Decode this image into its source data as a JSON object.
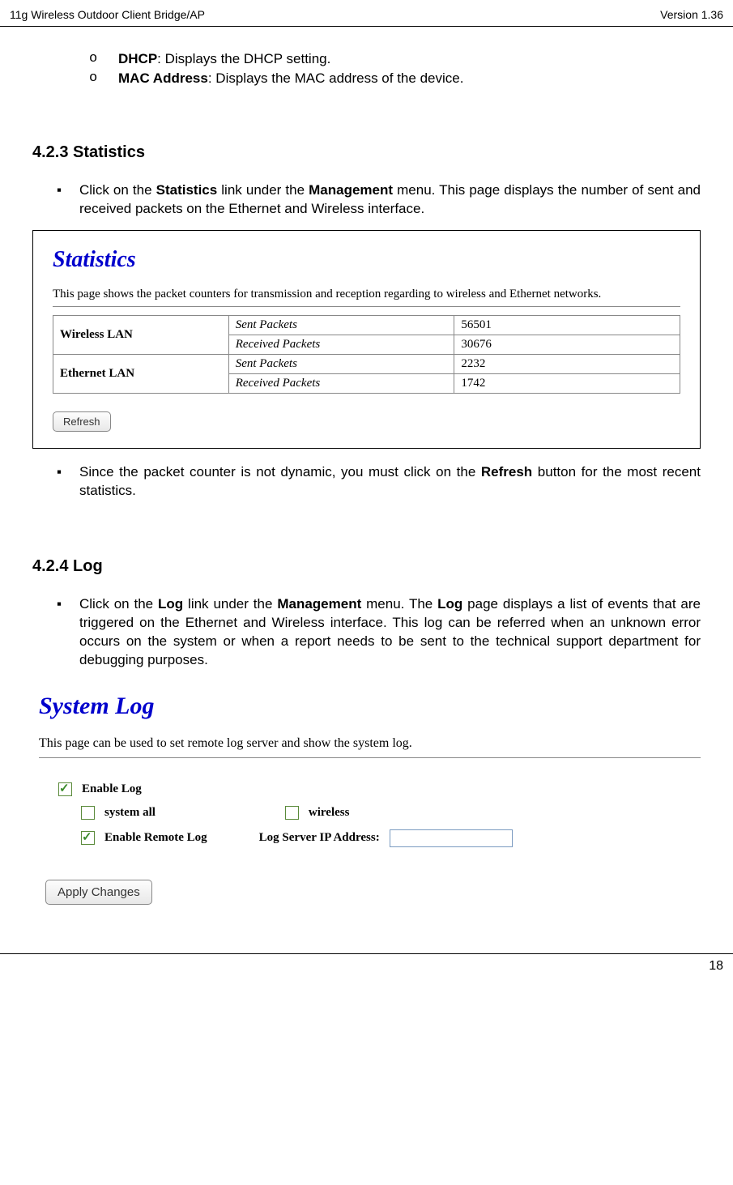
{
  "header": {
    "left": "11g Wireless Outdoor Client Bridge/AP",
    "right": "Version 1.36"
  },
  "list_o": [
    {
      "term": "DHCP",
      "desc": ": Displays the DHCP setting."
    },
    {
      "term": "MAC Address",
      "desc": ": Displays the MAC address of the device."
    }
  ],
  "section423": {
    "heading": "4.2.3  Statistics",
    "bullet_pre": "Click on the  ",
    "bullet_bold1": "Statistics",
    "bullet_mid": " link under the  ",
    "bullet_bold2": "Management",
    "bullet_post": " menu. This page displays the number of sent and received packets on the Ethernet and Wireless interface.",
    "panel": {
      "title": "Statistics",
      "desc": "This page shows the packet counters for transmission and reception regarding to wireless and Ethernet networks.",
      "rows": [
        {
          "iface": "Wireless LAN",
          "sent_label": "Sent Packets",
          "sent_val": "56501",
          "recv_label": "Received Packets",
          "recv_val": "30676"
        },
        {
          "iface": "Ethernet LAN",
          "sent_label": "Sent Packets",
          "sent_val": "2232",
          "recv_label": "Received Packets",
          "recv_val": "1742"
        }
      ],
      "button": "Refresh"
    },
    "bullet2_pre": "Since the packet counter is not dynamic, you must click on the ",
    "bullet2_bold": "Refresh",
    "bullet2_post": " button for the most recent statistics."
  },
  "section424": {
    "heading": "4.2.4  Log",
    "bullet_pre": "Click on the ",
    "bullet_bold1": "Log",
    "bullet_mid1": " link under the ",
    "bullet_bold2": "Management",
    "bullet_mid2": " menu. The ",
    "bullet_bold3": "Log",
    "bullet_post": " page displays a list of events that are triggered on the Ethernet and Wireless interface.  This log can be referred when an unknown error occurs on the system or when a report needs to be sent to the technical support department for debugging purposes.",
    "panel": {
      "title": "System Log",
      "desc": "This page can be used to set remote log server and show the system log.",
      "enable_log": "Enable Log",
      "system_all": "system all",
      "wireless": "wireless",
      "enable_remote": "Enable Remote Log",
      "log_server": "Log Server IP Address:",
      "button": "Apply Changes"
    }
  },
  "footer": {
    "page": "18"
  }
}
